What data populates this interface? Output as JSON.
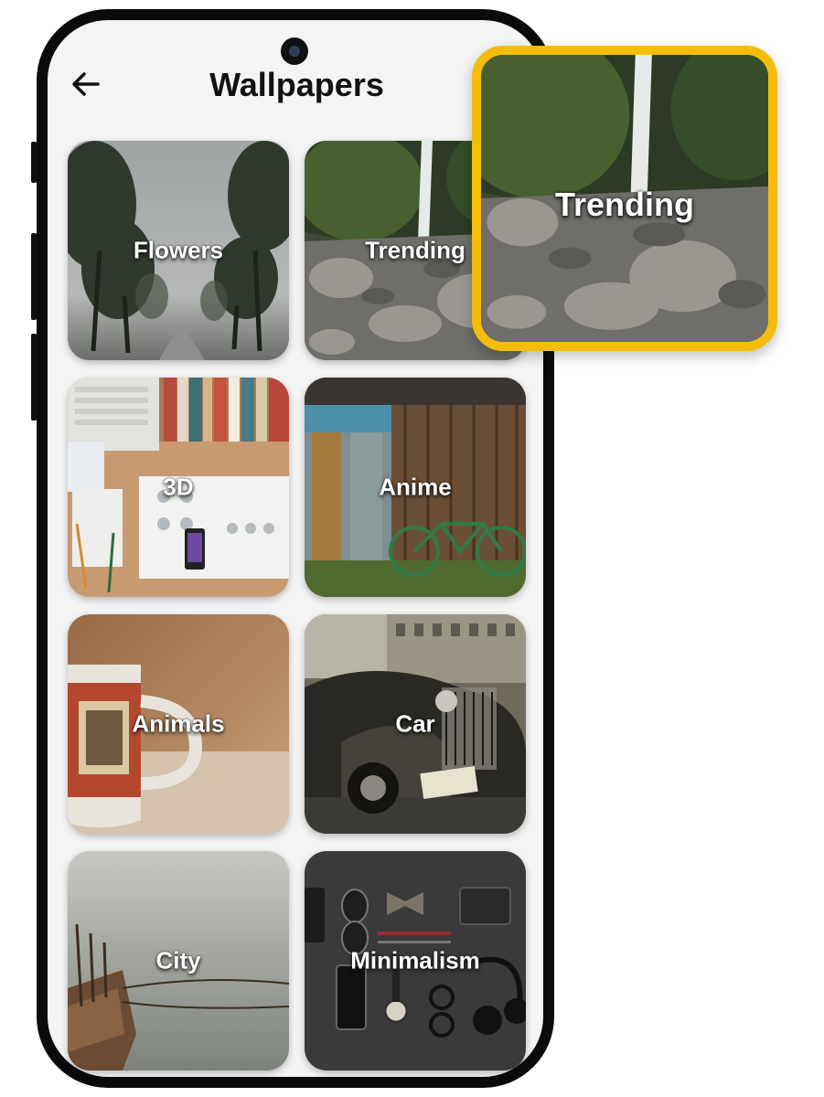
{
  "header": {
    "title": "Wallpapers",
    "back_icon": "arrow-left-icon"
  },
  "categories": [
    {
      "label": "Flowers"
    },
    {
      "label": "Trending"
    },
    {
      "label": "3D"
    },
    {
      "label": "Anime"
    },
    {
      "label": "Animals"
    },
    {
      "label": "Car"
    },
    {
      "label": "City"
    },
    {
      "label": "Minimalism"
    }
  ],
  "callout": {
    "label": "Trending",
    "border_color": "#f5bd0b"
  }
}
